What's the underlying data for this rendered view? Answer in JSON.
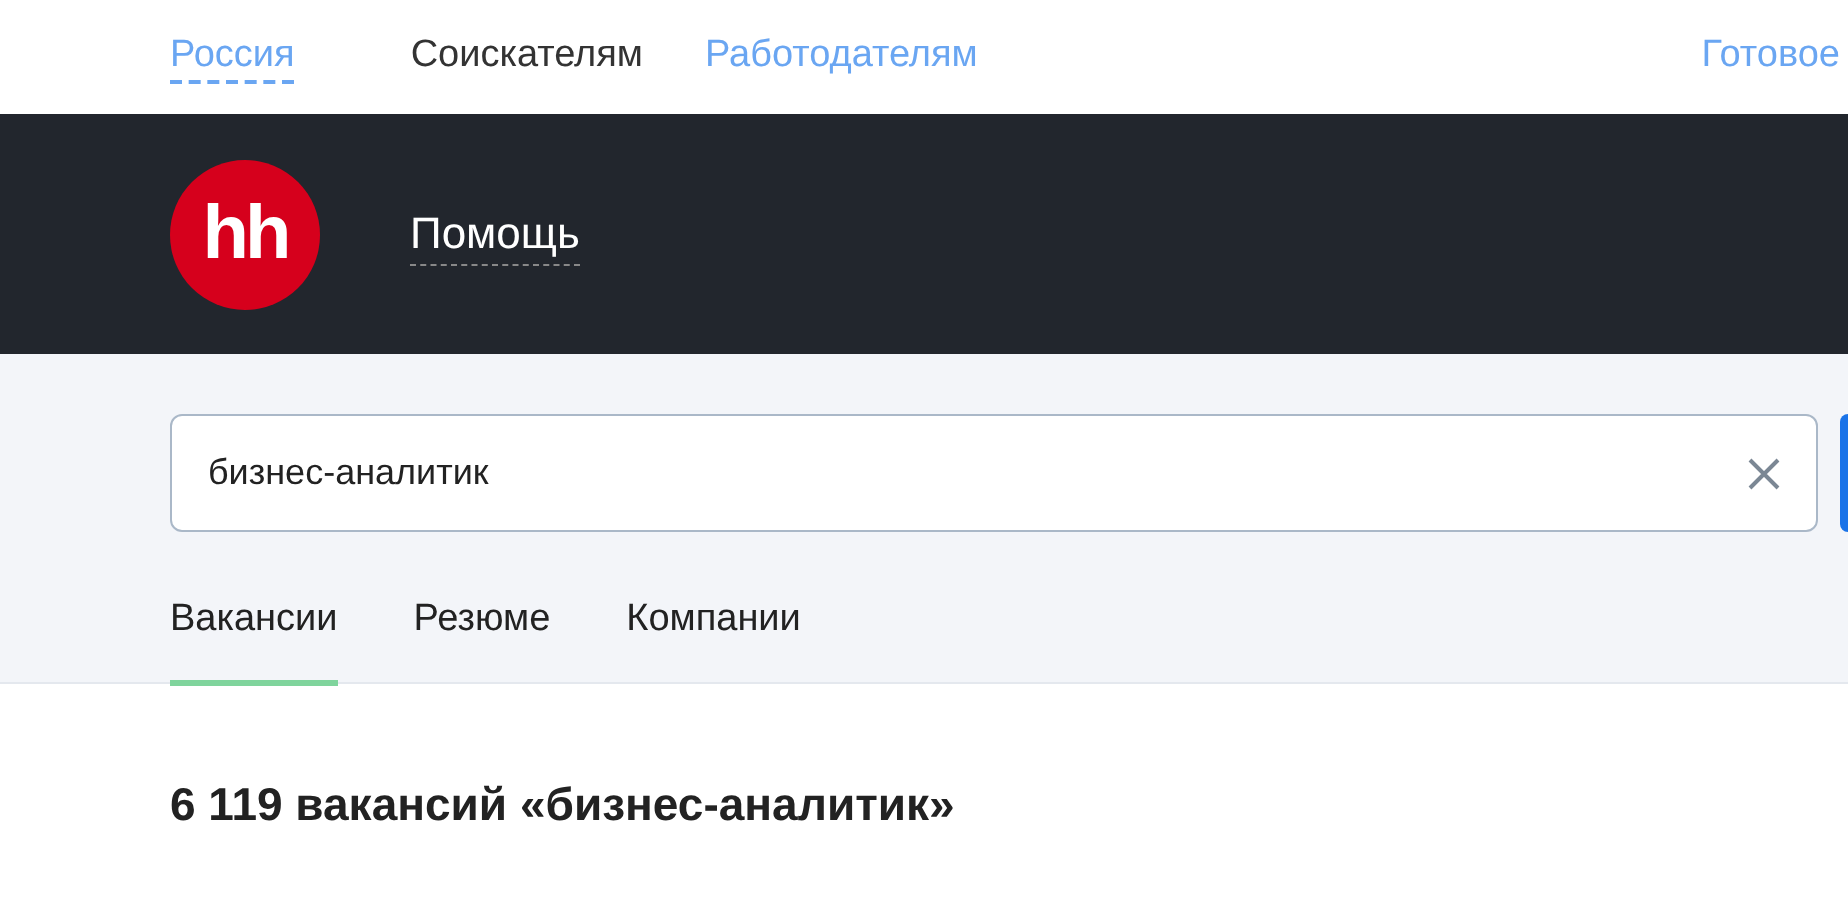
{
  "top_nav": {
    "region": "Россия",
    "links": [
      {
        "label": "Соискателям",
        "selected": true
      },
      {
        "label": "Работодателям",
        "selected": false
      }
    ],
    "right_link": "Готовое"
  },
  "header": {
    "logo": "hh",
    "title": "Помощь"
  },
  "search": {
    "value": "бизнес-аналитик"
  },
  "tabs": [
    {
      "label": "Вакансии",
      "selected": true
    },
    {
      "label": "Резюме",
      "selected": false
    },
    {
      "label": "Компании",
      "selected": false
    }
  ],
  "results_heading": "6 119 вакансий «бизнес-аналитик»"
}
